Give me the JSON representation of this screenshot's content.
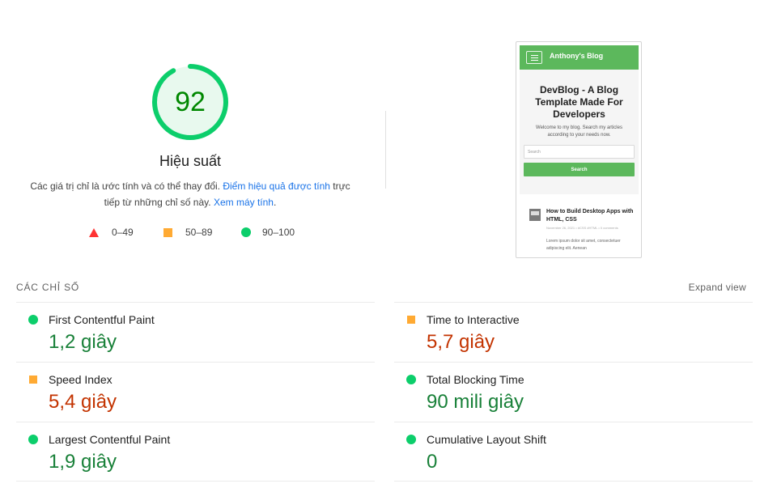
{
  "score": {
    "value": "92",
    "fraction": 0.92,
    "title": "Hiệu suất"
  },
  "description": {
    "text_before": "Các giá trị chỉ là ước tính và có thể thay đổi. ",
    "link1": "Điểm hiệu quả được tính",
    "text_middle": " trực tiếp từ những chỉ số này. ",
    "link2": "Xem máy tính",
    "text_after": "."
  },
  "legend": {
    "fail": "0–49",
    "average": "50–89",
    "pass": "90–100"
  },
  "screenshot": {
    "brand": "Anthony's Blog",
    "title": "DevBlog - A Blog Template Made For Developers",
    "subtitle": "Welcome to my blog. Search my articles according to your needs now.",
    "search_placeholder": "Search",
    "search_button": "Search",
    "post_title": "How to Build Desktop Apps with HTML, CSS",
    "post_meta": "November 26, 2021 • #CSS #HTML • 0 comments",
    "post_excerpt": "Lorem ipsum dolor sit amet, consectetuer adipiscing elit. Aenean"
  },
  "metrics": {
    "title": "CÁC CHỈ SỐ",
    "expand": "Expand view",
    "items": [
      {
        "label": "First Contentful Paint",
        "value": "1,2 giây",
        "rating": "pass"
      },
      {
        "label": "Time to Interactive",
        "value": "5,7 giây",
        "rating": "average"
      },
      {
        "label": "Speed Index",
        "value": "5,4 giây",
        "rating": "average"
      },
      {
        "label": "Total Blocking Time",
        "value": "90 mili giây",
        "rating": "pass"
      },
      {
        "label": "Largest Contentful Paint",
        "value": "1,9 giây",
        "rating": "pass"
      },
      {
        "label": "Cumulative Layout Shift",
        "value": "0",
        "rating": "pass"
      }
    ]
  },
  "colors": {
    "pass": "#0cce6b",
    "pass_text": "#188038",
    "average": "#ffaa33",
    "average_text": "#c33300",
    "fail": "#ff3333",
    "link": "#1a73e8"
  }
}
